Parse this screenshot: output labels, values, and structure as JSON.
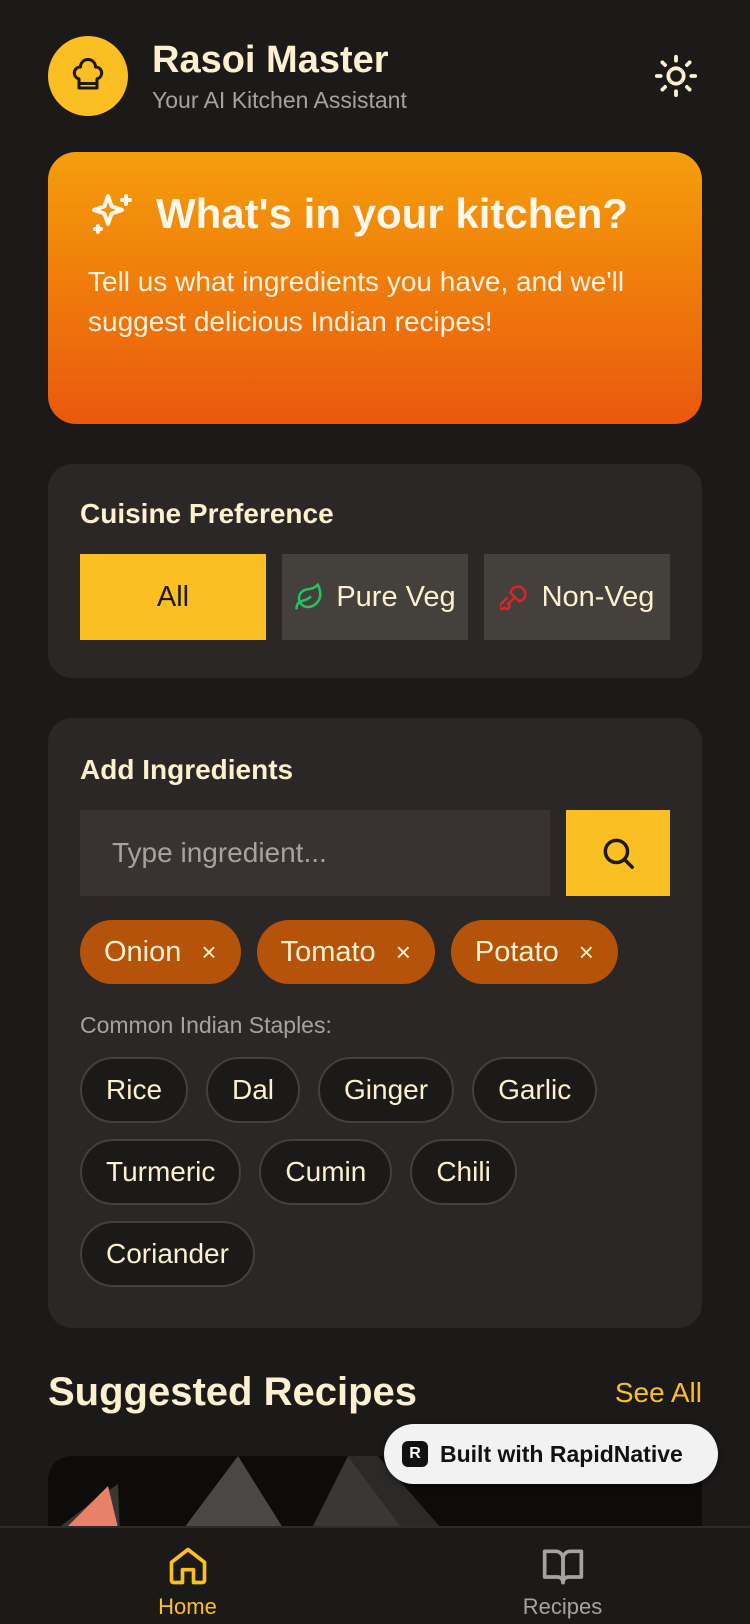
{
  "header": {
    "title": "Rasoi Master",
    "subtitle": "Your AI Kitchen Assistant",
    "logo_icon": "chef-hat-icon",
    "theme_icon": "sun-icon"
  },
  "hero": {
    "title": "What's in your kitchen?",
    "text": "Tell us what ingredients you have, and we'll suggest delicious Indian recipes!",
    "icon": "sparkles-icon"
  },
  "cuisine": {
    "title": "Cuisine Preference",
    "options": [
      {
        "label": "All",
        "active": true
      },
      {
        "label": "Pure Veg",
        "icon": "leaf-icon",
        "active": false
      },
      {
        "label": "Non-Veg",
        "icon": "drumstick-icon",
        "active": false
      }
    ]
  },
  "ingredients": {
    "title": "Add Ingredients",
    "input_placeholder": "Type ingredient...",
    "input_value": "",
    "selected": [
      {
        "label": "Onion",
        "remove": "×"
      },
      {
        "label": "Tomato",
        "remove": "×"
      },
      {
        "label": "Potato",
        "remove": "×"
      }
    ],
    "staples_label": "Common Indian Staples:",
    "staples": [
      "Rice",
      "Dal",
      "Ginger",
      "Garlic",
      "Turmeric",
      "Cumin",
      "Chili",
      "Coriander"
    ]
  },
  "recipes": {
    "title": "Suggested Recipes",
    "see_all": "See All"
  },
  "badge": {
    "logo_letter": "R",
    "text": "Built with RapidNative"
  },
  "tabs": [
    {
      "label": "Home",
      "icon": "home-icon",
      "active": true
    },
    {
      "label": "Recipes",
      "icon": "book-open-icon",
      "active": false
    }
  ],
  "colors": {
    "background": "#1c1a19",
    "card": "#2a2726",
    "accent": "#fbbf24",
    "hero_start": "#f59e0b",
    "hero_end": "#ea580c",
    "chip": "#b45309",
    "text": "#fdf0d0",
    "muted": "#a8a29e"
  }
}
